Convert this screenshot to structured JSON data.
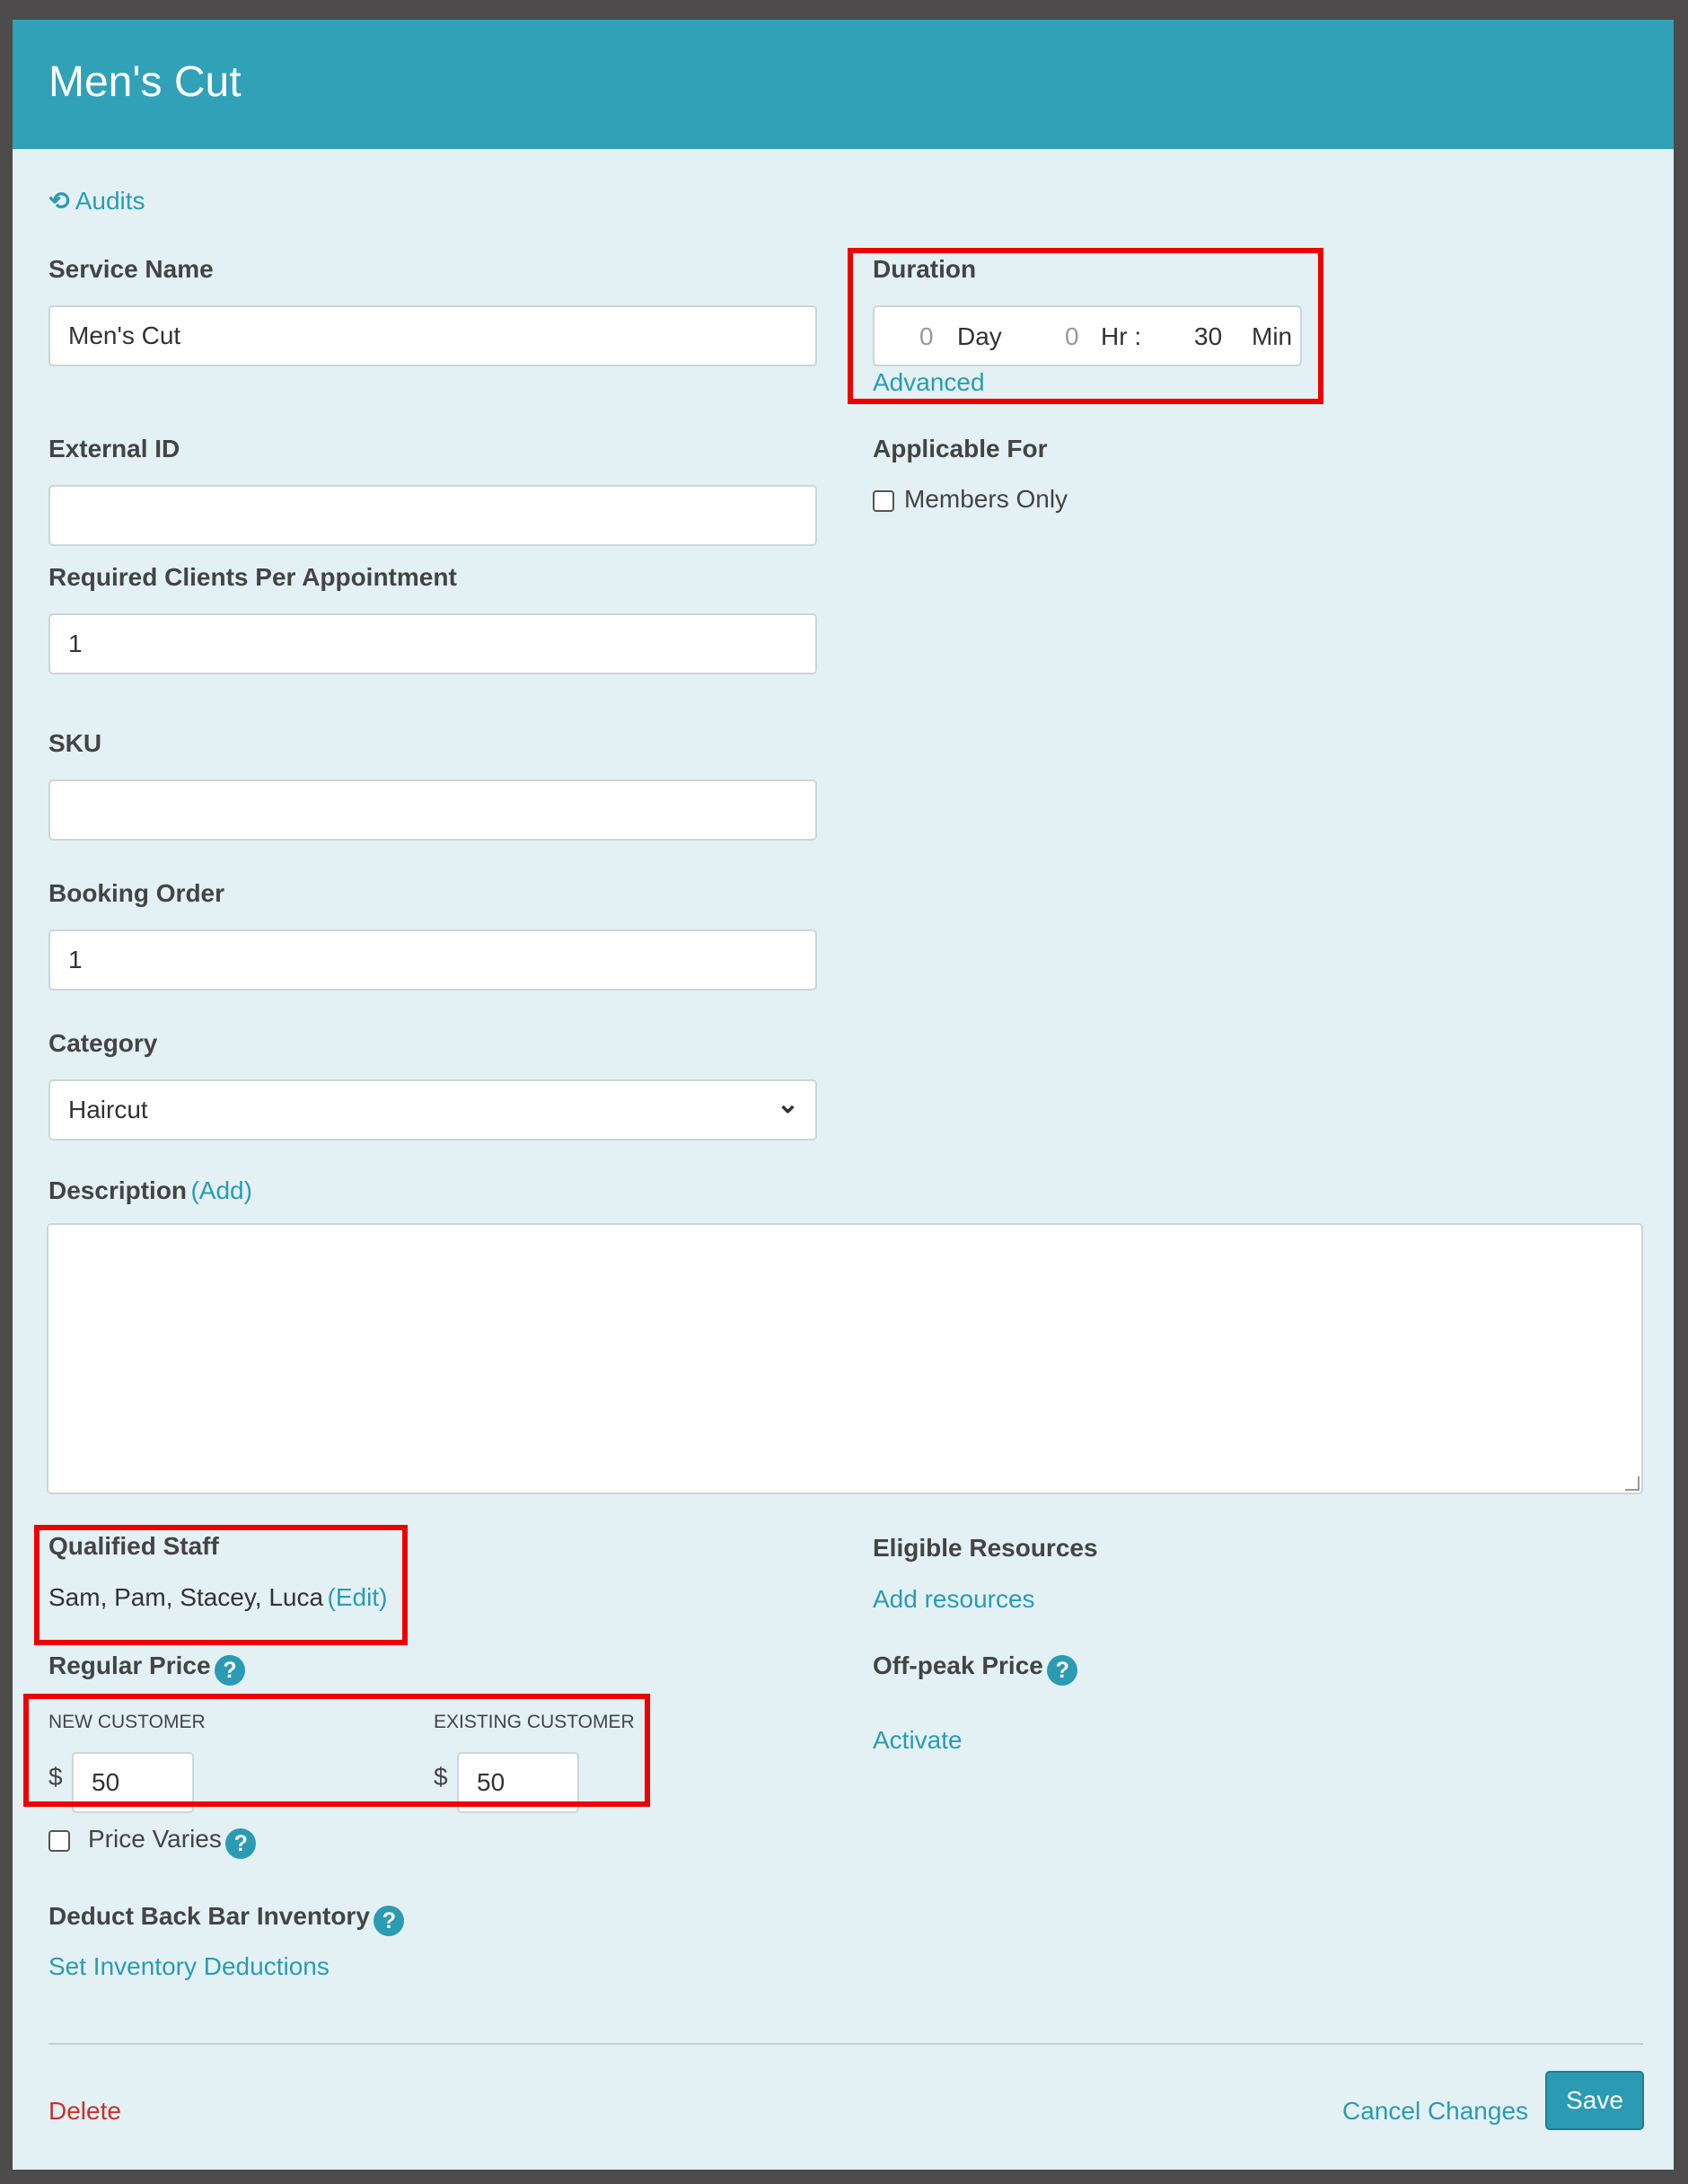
{
  "header": {
    "title": "Men's Cut"
  },
  "audits": {
    "label": "Audits"
  },
  "service_name": {
    "label": "Service Name",
    "value": "Men's Cut"
  },
  "duration": {
    "label": "Duration",
    "day_value": "0",
    "day_unit": "Day",
    "hr_value": "0",
    "hr_unit": "Hr :",
    "min_value": "30",
    "min_unit": "Min",
    "advanced_label": "Advanced"
  },
  "external_id": {
    "label": "External ID",
    "value": ""
  },
  "applicable_for": {
    "label": "Applicable For",
    "members_only_label": "Members Only"
  },
  "required_clients": {
    "label": "Required Clients Per Appointment",
    "value": "1"
  },
  "sku": {
    "label": "SKU",
    "value": ""
  },
  "booking_order": {
    "label": "Booking Order",
    "value": "1"
  },
  "category": {
    "label": "Category",
    "value": "Haircut"
  },
  "description": {
    "label": "Description",
    "add_label": "(Add)",
    "value": ""
  },
  "qualified_staff": {
    "label": "Qualified Staff",
    "names": "Sam, Pam, Stacey, Luca",
    "edit_label": "(Edit)"
  },
  "eligible_resources": {
    "label": "Eligible Resources",
    "add_label": "Add resources"
  },
  "regular_price": {
    "label": "Regular Price",
    "new_customer_label": "NEW CUSTOMER",
    "existing_customer_label": "EXISTING CUSTOMER",
    "currency": "$",
    "new_value": "50",
    "existing_value": "50"
  },
  "offpeak_price": {
    "label": "Off-peak Price",
    "activate_label": "Activate"
  },
  "price_varies": {
    "label": "Price Varies"
  },
  "back_bar": {
    "label": "Deduct Back Bar Inventory",
    "set_label": "Set Inventory Deductions"
  },
  "footer": {
    "delete_label": "Delete",
    "cancel_label": "Cancel Changes",
    "save_label": "Save"
  },
  "icons": {
    "help": "?",
    "audits": "⟲",
    "chevron": "⌄"
  },
  "colors": {
    "header": "#31a1b8",
    "link": "#2b9bb3",
    "delete": "#c9302c",
    "highlight": "#ee0000"
  }
}
